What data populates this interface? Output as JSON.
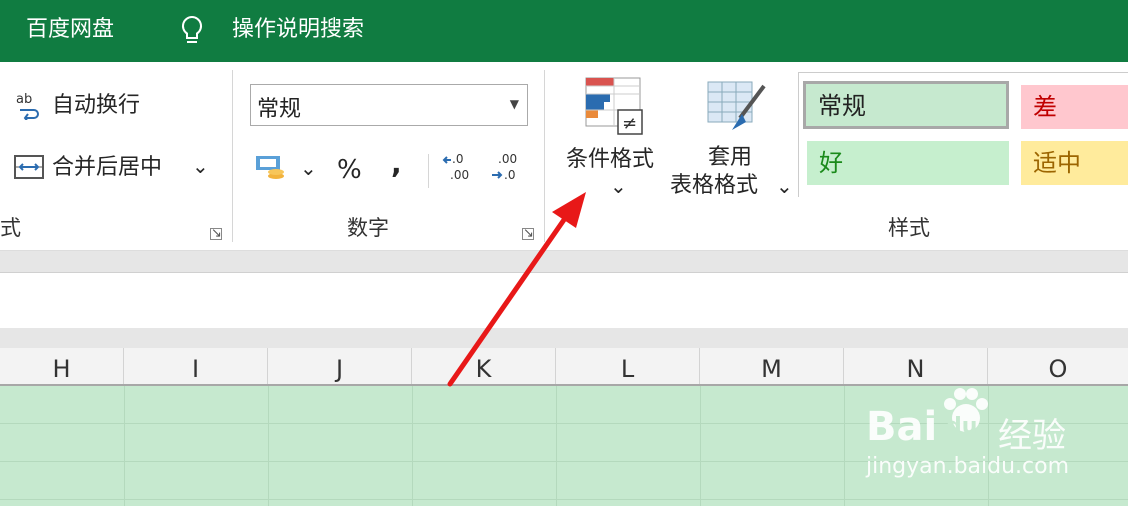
{
  "titlebar": {
    "app": "百度网盘",
    "search_hint": "操作说明搜索"
  },
  "alignment": {
    "wrap_label": "自动换行",
    "merge_label": "合并后居中",
    "group_label": "式"
  },
  "number": {
    "format_value": "常规",
    "percent": "%",
    "comma": ",",
    "group_label": "数字"
  },
  "styles": {
    "conditional_label": "条件格式",
    "table_label_1": "套用",
    "table_label_2": "表格格式",
    "group_label": "样式",
    "cells": {
      "normal": "常规",
      "bad": "差",
      "good": "好",
      "neutral": "适中"
    }
  },
  "columns": [
    "H",
    "I",
    "J",
    "K",
    "L",
    "M",
    "N",
    "O"
  ],
  "watermark": {
    "brand": "Bai",
    "brand2": "du",
    "suffix": "经验",
    "url": "jingyan.baidu.com"
  },
  "colors": {
    "excel_green": "#107c41",
    "selection_fill": "#c6e9cf",
    "arrow": "#e81818"
  }
}
